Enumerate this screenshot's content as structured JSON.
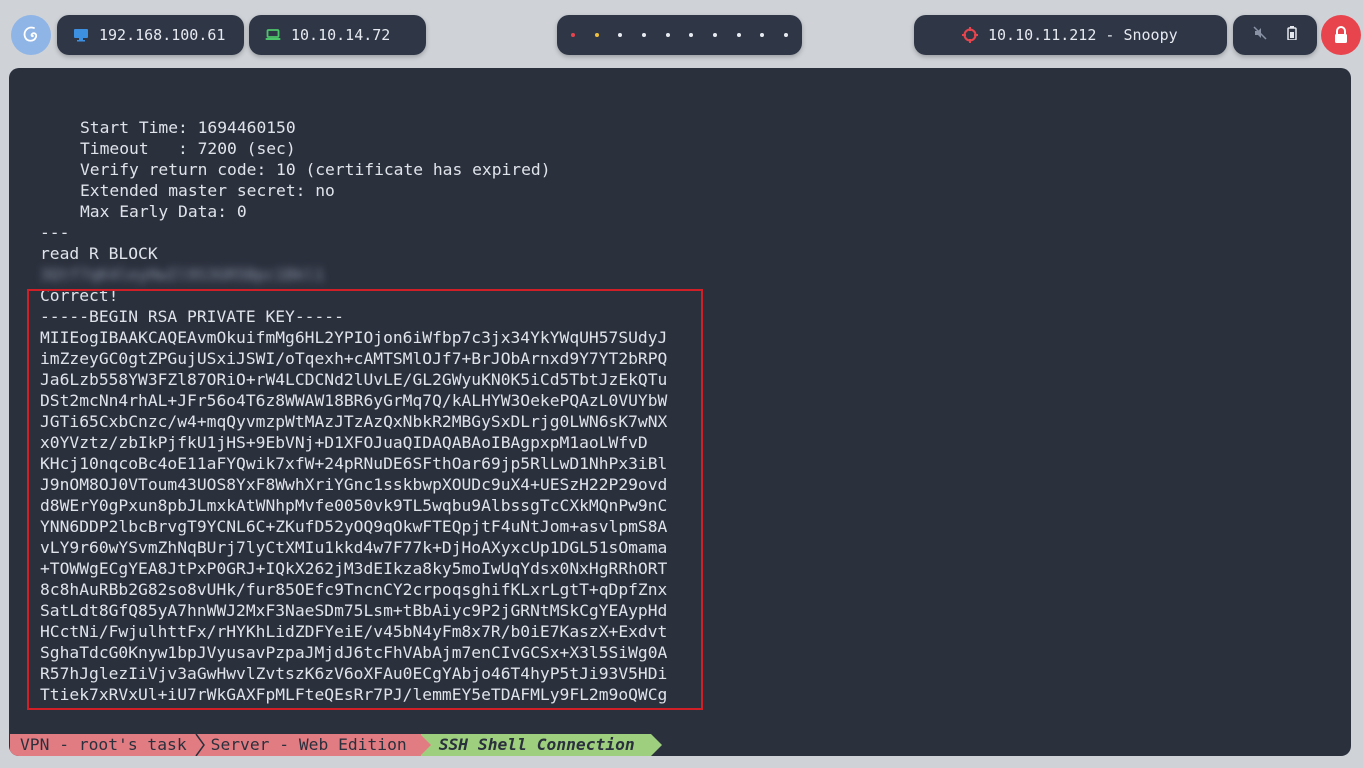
{
  "topbar": {
    "host_ip": "192.168.100.61",
    "vpn_ip": "10.10.14.72",
    "target": "10.10.11.212 - Snoopy",
    "workspaces": 10,
    "colors": {
      "pill_bg": "#2f3747",
      "accent_blue": "#3d8fe0",
      "accent_green": "#4cc46a",
      "target_red": "#e8444d",
      "lock_bg": "#e8444d"
    }
  },
  "terminal": {
    "lines": [
      {
        "text": "Start Time: 1694460150",
        "indent": true
      },
      {
        "text": "Timeout   : 7200 (sec)",
        "indent": true
      },
      {
        "text": "Verify return code: 10 (certificate has expired)",
        "indent": true
      },
      {
        "text": "Extended master secret: no",
        "indent": true
      },
      {
        "text": "Max Early Data: 0",
        "indent": true
      },
      {
        "text": "---",
        "indent": false
      },
      {
        "text": "read R BLOCK",
        "indent": false
      },
      {
        "text": "3Qtf7qK4leyHwIl9S3GR5Bpc1Bkl1",
        "indent": false,
        "redacted": true
      },
      {
        "text": "Correct!",
        "indent": false
      },
      {
        "text": "-----BEGIN RSA PRIVATE KEY-----",
        "indent": false
      },
      {
        "text": "MIIEogIBAAKCAQEAvmOkuifmMg6HL2YPIOjon6iWfbp7c3jx34YkYWqUH57SUdyJ",
        "indent": false
      },
      {
        "text": "imZzeyGC0gtZPGujUSxiJSWI/oTqexh+cAMTSMlOJf7+BrJObArnxd9Y7YT2bRPQ",
        "indent": false
      },
      {
        "text": "Ja6Lzb558YW3FZl87ORiO+rW4LCDCNd2lUvLE/GL2GWyuKN0K5iCd5TbtJzEkQTu",
        "indent": false
      },
      {
        "text": "DSt2mcNn4rhAL+JFr56o4T6z8WWAW18BR6yGrMq7Q/kALHYW3OekePQAzL0VUYbW",
        "indent": false
      },
      {
        "text": "JGTi65CxbCnzc/w4+mqQyvmzpWtMAzJTzAzQxNbkR2MBGySxDLrjg0LWN6sK7wNX",
        "indent": false
      },
      {
        "text": "x0YVztz/zbIkPjfkU1jHS+9EbVNj+D1XFOJuaQIDAQABAoIBAgpxpM1aoLWfvD",
        "indent": false
      },
      {
        "text": "KHcj10nqcoBc4oE11aFYQwik7xfW+24pRNuDE6SFthOar69jp5RlLwD1NhPx3iBl",
        "indent": false
      },
      {
        "text": "J9nOM8OJ0VToum43UOS8YxF8WwhXriYGnc1sskbwpXOUDc9uX4+UESzH22P29ovd",
        "indent": false
      },
      {
        "text": "d8WErY0gPxun8pbJLmxkAtWNhpMvfe0050vk9TL5wqbu9AlbssgTcCXkMQnPw9nC",
        "indent": false
      },
      {
        "text": "YNN6DDP2lbcBrvgT9YCNL6C+ZKufD52yOQ9qOkwFTEQpjtF4uNtJom+asvlpmS8A",
        "indent": false
      },
      {
        "text": "vLY9r60wYSvmZhNqBUrj7lyCtXMIu1kkd4w7F77k+DjHoAXyxcUp1DGL51sOmama",
        "indent": false
      },
      {
        "text": "+TOWWgECgYEA8JtPxP0GRJ+IQkX262jM3dEIkza8ky5moIwUqYdsx0NxHgRRhORT",
        "indent": false
      },
      {
        "text": "8c8hAuRBb2G82so8vUHk/fur85OEfc9TncnCY2crpoqsghifKLxrLgtT+qDpfZnx",
        "indent": false
      },
      {
        "text": "SatLdt8GfQ85yA7hnWWJ2MxF3NaeSDm75Lsm+tBbAiyc9P2jGRNtMSkCgYEAypHd",
        "indent": false
      },
      {
        "text": "HCctNi/FwjulhttFx/rHYKhLidZDFYeiE/v45bN4yFm8x7R/b0iE7KaszX+Exdvt",
        "indent": false
      },
      {
        "text": "SghaTdcG0Knyw1bpJVyusavPzpaJMjdJ6tcFhVAbAjm7enCIvGCSx+X3l5SiWg0A",
        "indent": false
      },
      {
        "text": "R57hJglezIiVjv3aGwHwvlZvtszK6zV6oXFAu0ECgYAbjo46T4hyP5tJi93V5HDi",
        "indent": false
      },
      {
        "text": "Ttiek7xRVxUl+iU7rWkGAXFpMLFteQEsRr7PJ/lemmEY5eTDAFMLy9FL2m9oQWCg",
        "indent": false
      }
    ]
  },
  "statusbar": {
    "seg1": "VPN - root's task",
    "seg2": "Server - Web Edition",
    "seg3": "SSH Shell Connection",
    "colors": {
      "pink": "#e17c82",
      "green": "#9ecf7f"
    }
  }
}
